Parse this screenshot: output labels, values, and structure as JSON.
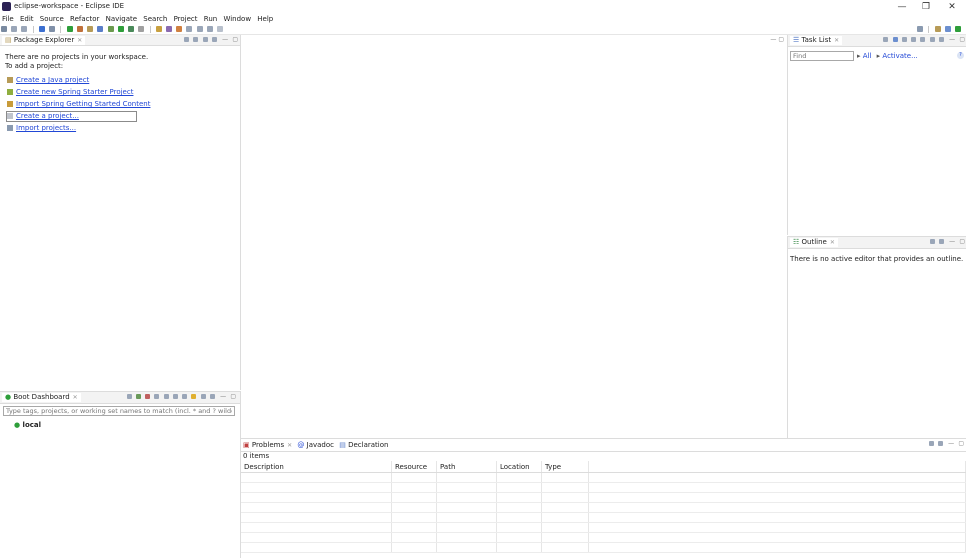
{
  "window": {
    "title": "eclipse-workspace - Eclipse IDE",
    "controls": {
      "minimize": "—",
      "restore": "❐",
      "close": "✕"
    }
  },
  "menu": [
    "File",
    "Edit",
    "Source",
    "Refactor",
    "Navigate",
    "Search",
    "Project",
    "Run",
    "Window",
    "Help"
  ],
  "package_explorer": {
    "tab_label": "Package Explorer",
    "intro_line1": "There are no projects in your workspace.",
    "intro_line2": "To add a project:",
    "links": [
      "Create a Java project",
      "Create new Spring Starter Project",
      "Import Spring Getting Started Content",
      "Create a project...",
      "Import projects..."
    ]
  },
  "boot_dashboard": {
    "tab_label": "Boot Dashboard",
    "filter_placeholder": "Type tags, projects, or working set names to match (incl. * and ? wildcards)",
    "nodes": [
      "local"
    ]
  },
  "task_list": {
    "tab_label": "Task List",
    "find_placeholder": "Find",
    "all_label": "All",
    "activate_label": "Activate..."
  },
  "outline": {
    "tab_label": "Outline",
    "message": "There is no active editor that provides an outline."
  },
  "bottom_panel": {
    "tabs": [
      "Problems",
      "Javadoc",
      "Declaration"
    ],
    "items_count": "0 items",
    "columns": [
      "Description",
      "Resource",
      "Path",
      "Location",
      "Type"
    ]
  },
  "colors": {
    "accent": "#2147d6",
    "boot_green": "#2e9e3a"
  }
}
